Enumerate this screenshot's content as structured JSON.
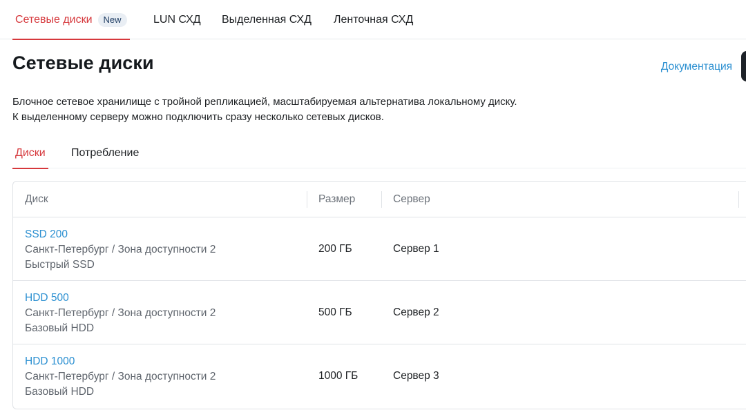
{
  "top_tabs": [
    {
      "label": "Сетевые диски",
      "badge": "New",
      "active": true
    },
    {
      "label": "LUN СХД",
      "active": false
    },
    {
      "label": "Выделенная СХД",
      "active": false
    },
    {
      "label": "Ленточная СХД",
      "active": false
    }
  ],
  "header": {
    "title": "Сетевые диски",
    "doc_link": "Документация"
  },
  "description": {
    "line1": "Блочное сетевое хранилище с тройной репликацией, масштабируемая альтернатива локальному диску.",
    "line2": "К выделенному серверу можно подключить сразу несколько сетевых дисков."
  },
  "sub_tabs": [
    {
      "label": "Диски",
      "active": true
    },
    {
      "label": "Потребление",
      "active": false
    }
  ],
  "table": {
    "columns": [
      "Диск",
      "Размер",
      "Сервер"
    ],
    "rows": [
      {
        "name": "SSD 200",
        "location": "Санкт-Петербург / Зона доступности 2",
        "type": "Быстрый SSD",
        "size": "200 ГБ",
        "server": "Сервер 1"
      },
      {
        "name": "HDD 500",
        "location": "Санкт-Петербург / Зона доступности 2",
        "type": "Базовый HDD",
        "size": "500 ГБ",
        "server": "Сервер 2"
      },
      {
        "name": "HDD 1000",
        "location": "Санкт-Петербург / Зона доступности 2",
        "type": "Базовый HDD",
        "size": "1000 ГБ",
        "server": "Сервер 3"
      }
    ]
  },
  "colors": {
    "accent": "#d6383c",
    "link": "#2a8fd1",
    "badge_bg": "#e9eef4"
  }
}
